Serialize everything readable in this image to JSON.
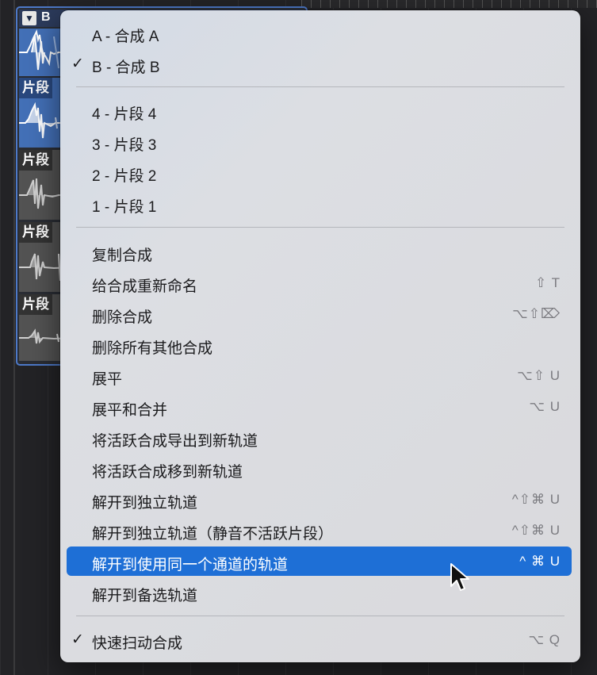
{
  "comp_header": {
    "disclosure_glyph": "▼",
    "label": "B"
  },
  "takes": [
    {
      "label": "片段",
      "style": "blue"
    },
    {
      "label": "片段",
      "style": "gray"
    },
    {
      "label": "片段",
      "style": "gray"
    },
    {
      "label": "片段",
      "style": "gray"
    }
  ],
  "menu": {
    "comps": [
      {
        "label": "A - 合成 A",
        "checked": false
      },
      {
        "label": "B - 合成 B",
        "checked": true,
        "check_glyph": "✓"
      }
    ],
    "takes": [
      {
        "label": "4 - 片段 4"
      },
      {
        "label": "3 - 片段 3"
      },
      {
        "label": "2 - 片段 2"
      },
      {
        "label": "1 - 片段 1"
      }
    ],
    "actions": [
      {
        "label": "复制合成",
        "shortcut": ""
      },
      {
        "label": "给合成重新命名",
        "shortcut": "⇧ T"
      },
      {
        "label": "删除合成",
        "shortcut": "⌥⇧⌦"
      },
      {
        "label": "删除所有其他合成",
        "shortcut": ""
      },
      {
        "label": "展平",
        "shortcut": "⌥⇧ U"
      },
      {
        "label": "展平和合并",
        "shortcut": "⌥ U"
      },
      {
        "label": "将活跃合成导出到新轨道",
        "shortcut": ""
      },
      {
        "label": "将活跃合成移到新轨道",
        "shortcut": ""
      },
      {
        "label": "解开到独立轨道",
        "shortcut": "^⇧⌘ U"
      },
      {
        "label": "解开到独立轨道（静音不活跃片段）",
        "shortcut": "^⇧⌘ U"
      },
      {
        "label": "解开到使用同一个通道的轨道",
        "shortcut": "^ ⌘ U",
        "highlighted": true
      },
      {
        "label": "解开到备选轨道",
        "shortcut": ""
      }
    ],
    "options": [
      {
        "label": "快速扫动合成",
        "checked": true,
        "check_glyph": "✓",
        "shortcut": "⌥ Q"
      }
    ]
  },
  "colors": {
    "highlight": "#1e6fd6",
    "take_blue": "#4370b7",
    "take_gray": "#535353"
  },
  "cursor_icon": "arrow-pointer-icon"
}
